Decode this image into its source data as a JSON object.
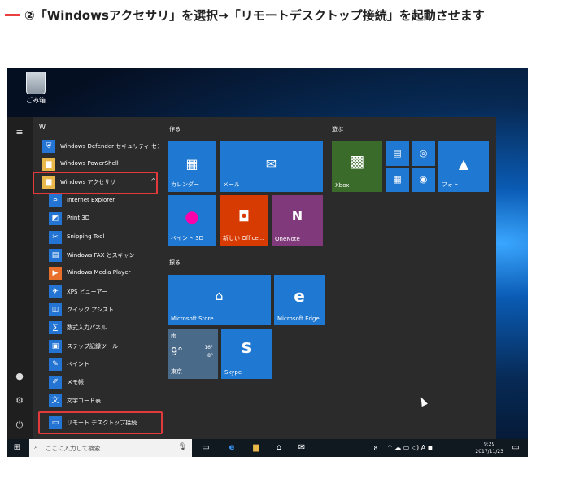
{
  "heading": "②「Windowsアクセサリ」を選択→「リモートデスクトップ接続」を起動させます",
  "desktop": {
    "recycle_bin_label": "ごみ箱"
  },
  "start_menu": {
    "letter": "W",
    "apps": [
      {
        "label": "Windows Defender セキュリティ セン..."
      },
      {
        "label": "Windows PowerShell"
      },
      {
        "label": "Windows アクセサリ"
      },
      {
        "label": "Internet Explorer"
      },
      {
        "label": "Print 3D"
      },
      {
        "label": "Snipping Tool"
      },
      {
        "label": "Windows FAX とスキャン"
      },
      {
        "label": "Windows Media Player"
      },
      {
        "label": "XPS ビューアー"
      },
      {
        "label": "クイック アシスト"
      },
      {
        "label": "数式入力パネル"
      },
      {
        "label": "ステップ記録ツール"
      },
      {
        "label": "ペイント"
      },
      {
        "label": "メモ帳"
      },
      {
        "label": "文字コード表"
      },
      {
        "label": "リモート デスクトップ接続"
      }
    ],
    "groups": {
      "create": "作る",
      "play": "遊ぶ",
      "explore": "探る"
    },
    "tiles": {
      "calendar": "カレンダー",
      "mail": "メール",
      "paint3d": "ペイント 3D",
      "office": "新しい Office...",
      "onenote": "OneNote",
      "xbox": "Xbox",
      "photos": "フォト",
      "store": "Microsoft Store",
      "edge": "Microsoft Edge",
      "skype": "Skype",
      "weather_cond": "雨",
      "weather_temp": "9°",
      "weather_hi": "16°",
      "weather_lo": "8°",
      "weather_city": "東京"
    }
  },
  "taskbar": {
    "search_placeholder": "ここに入力して検索",
    "ime": "A",
    "time": "9:29",
    "date": "2017/11/23"
  },
  "colors": {
    "tile_blue": "#1f78d1",
    "office_red": "#d83b01",
    "onenote_purple": "#80397b",
    "highlight": "#e23a3a",
    "heading_dash": "#e8413f"
  }
}
